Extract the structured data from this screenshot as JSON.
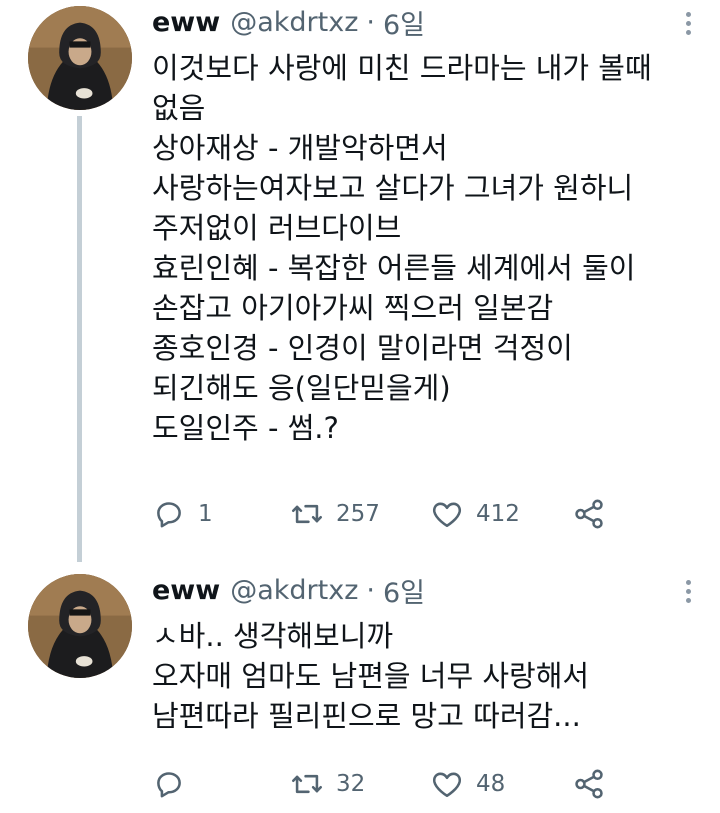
{
  "tweets": [
    {
      "name": "eww",
      "handle": "@akdrtxz",
      "separator": "·",
      "time": "6일",
      "lines": [
        "이것보다 사랑에 미친 드라마는 내가 볼때",
        "없음",
        "상아재상 - 개발악하면서",
        "사랑하는여자보고 살다가 그녀가 원하니",
        "주저없이 러브다이브",
        "효린인혜 - 복잡한 어른들 세계에서 둘이",
        "손잡고 아기아가씨 찍으러 일본감",
        "종호인경 - 인경이 말이라면 걱정이",
        "되긴해도 응(일단믿을게)",
        "도일인주 - 썸.?"
      ],
      "replies": "1",
      "retweets": "257",
      "likes": "412"
    },
    {
      "name": "eww",
      "handle": "@akdrtxz",
      "separator": "·",
      "time": "6일",
      "lines": [
        "ㅅ바.. 생각해보니까",
        "오자매 엄마도 남편을 너무 사랑해서",
        "남편따라 필리핀으로 망고 따러감..."
      ],
      "replies": "",
      "retweets": "32",
      "likes": "48"
    }
  ],
  "icons": {
    "reply": "reply-icon",
    "retweet": "retweet-icon",
    "like": "like-icon",
    "share": "share-icon",
    "more": "more-icon"
  },
  "colors": {
    "text": "#0f1419",
    "muted": "#536471",
    "thread_line": "#c4cfd6"
  }
}
